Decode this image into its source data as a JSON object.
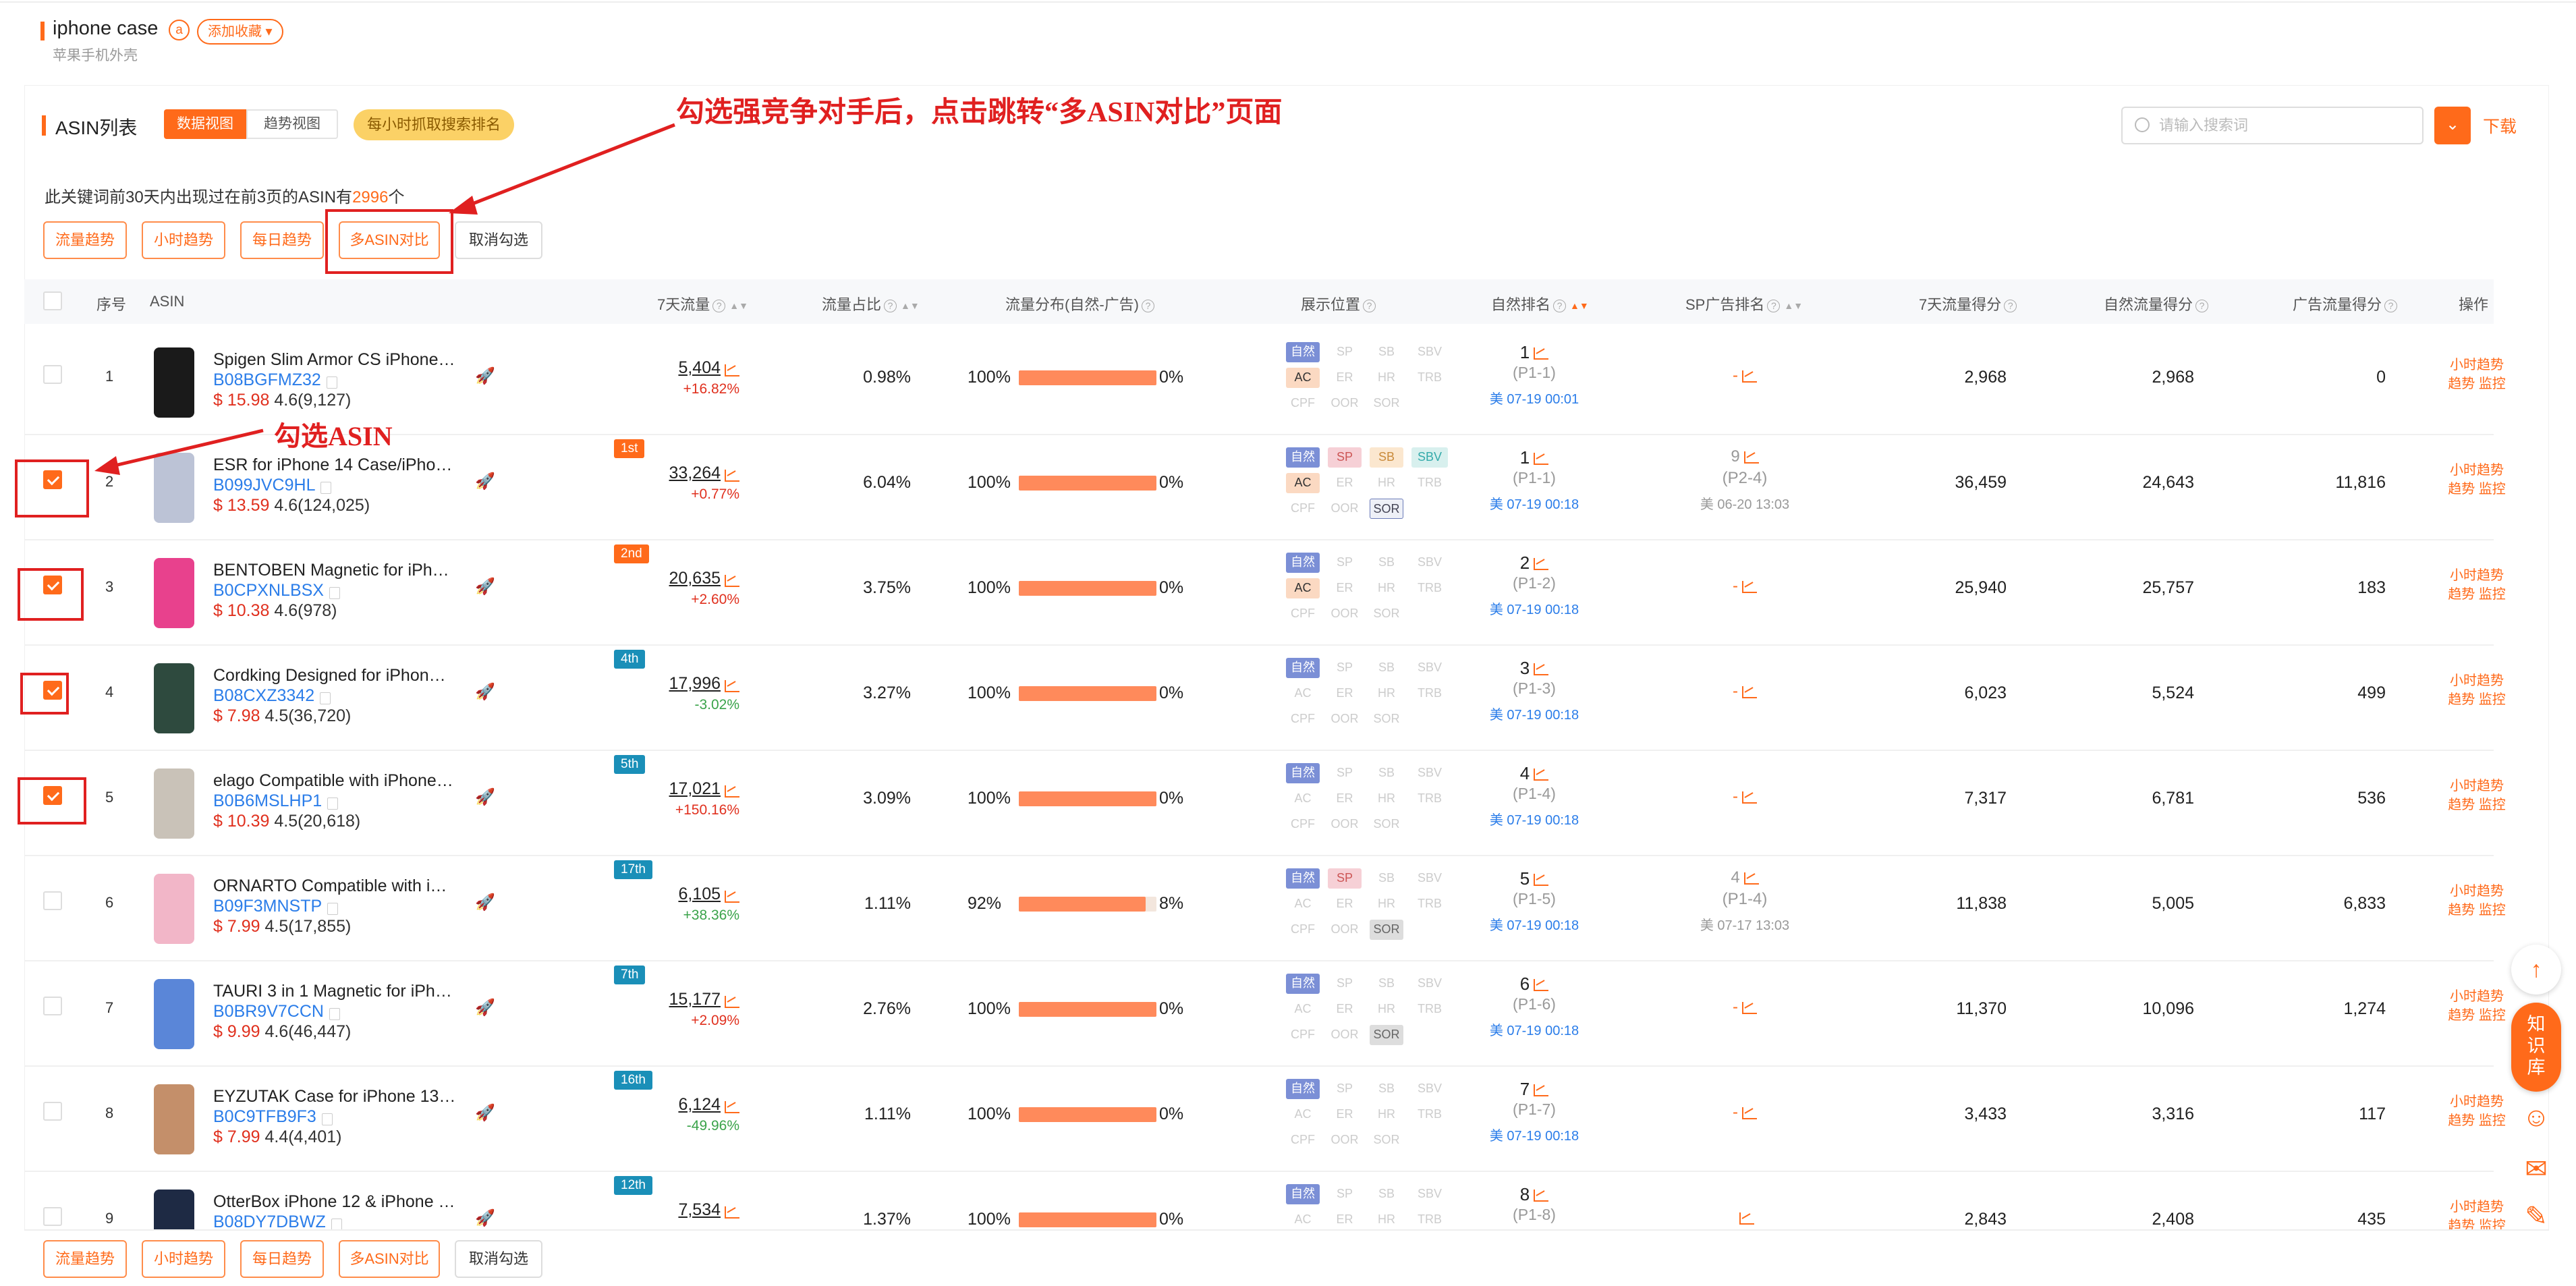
{
  "header": {
    "keyword": "iphone case",
    "badge": "a",
    "favorite": "添加收藏 ▾",
    "subtitle": "苹果手机外壳"
  },
  "section": {
    "title": "ASIN列表",
    "tab_data": "数据视图",
    "tab_trend": "趋势视图",
    "hourly_pill": "每小时抓取搜索排名"
  },
  "search": {
    "placeholder": "请输入搜索词",
    "dropdown": "⌄",
    "download": "下载"
  },
  "info": {
    "prefix": "此关键词前30天内出现过在前3页的ASIN有",
    "count": "2996",
    "suffix": "个"
  },
  "actions": {
    "traffic_trend": "流量趋势",
    "hourly_trend": "小时趋势",
    "daily_trend": "每日趋势",
    "multi_asin": "多ASIN对比",
    "cancel": "取消勾选"
  },
  "columns": {
    "index": "序号",
    "asin": "ASIN",
    "traffic7": "7天流量",
    "share": "流量占比",
    "dist": "流量分布(自然-广告)",
    "display": "展示位置",
    "natural_rank": "自然排名",
    "sp_rank": "SP广告排名",
    "score7": "7天流量得分",
    "natural_score": "自然流量得分",
    "ad_score": "广告流量得分",
    "ops": "操作"
  },
  "tag_labels": [
    "自然",
    "SP",
    "SB",
    "SBV",
    "AC",
    "ER",
    "HR",
    "TRB",
    "CPF",
    "OOR",
    "SOR"
  ],
  "ops_labels": {
    "hourly": "小时趋势",
    "trend": "趋势",
    "monitor": "监控"
  },
  "annotations": {
    "top": "勾选强竞争对手后，点击跳转“多ASIN对比”页面",
    "left": "勾选ASIN"
  },
  "colors": {
    "accent": "#ff6a1a",
    "link": "#2b7de9",
    "annotation": "#e02020"
  },
  "rows": [
    {
      "idx": "1",
      "title": "Spigen Slim Armor CS iPhone…",
      "asin": "B08BGFMZ32",
      "price": "$ 15.98",
      "rating": "4.6(9,127)",
      "badge": "",
      "traffic": "5,404",
      "change": "+16.82%",
      "up": true,
      "share": "0.98%",
      "nat_pct": "100%",
      "ad_pct": "0%",
      "nat_frac": 1.0,
      "tags": [
        "on",
        "off",
        "off",
        "off",
        "ac",
        "off",
        "off",
        "off",
        "off",
        "off",
        "off"
      ],
      "rank": "1",
      "page": "(P1-1)",
      "time": "美 07-19 00:01",
      "sp": "-",
      "sp_page": "",
      "sp_time": "",
      "s7": "2,968",
      "sn": "2,968",
      "sa": "0",
      "checked": false,
      "img": "black"
    },
    {
      "idx": "2",
      "title": "ESR for iPhone 14 Case/iPho…",
      "asin": "B099JVC9HL",
      "price": "$ 13.59",
      "rating": "4.6(124,025)",
      "badge": "1st",
      "traffic": "33,264",
      "change": "+0.77%",
      "up": true,
      "share": "6.04%",
      "nat_pct": "100%",
      "ad_pct": "0%",
      "nat_frac": 1.0,
      "tags": [
        "on",
        "sp",
        "sb",
        "sbv",
        "ac",
        "off",
        "off",
        "off",
        "off",
        "off",
        "sor"
      ],
      "rank": "1",
      "page": "(P1-1)",
      "time": "美 07-19 00:18",
      "sp": "9",
      "sp_page": "(P2-4)",
      "sp_time": "美 06-20 13:03",
      "s7": "36,459",
      "sn": "24,643",
      "sa": "11,816",
      "checked": true,
      "img": "clear"
    },
    {
      "idx": "3",
      "title": "BENTOBEN Magnetic for iPh…",
      "asin": "B0CPXNLBSX",
      "price": "$ 10.38",
      "rating": "4.6(978)",
      "badge": "2nd",
      "traffic": "20,635",
      "change": "+2.60%",
      "up": true,
      "share": "3.75%",
      "nat_pct": "100%",
      "ad_pct": "0%",
      "nat_frac": 1.0,
      "tags": [
        "on",
        "off",
        "off",
        "off",
        "ac",
        "off",
        "off",
        "off",
        "off",
        "off",
        "off"
      ],
      "rank": "2",
      "page": "(P1-2)",
      "time": "美 07-19 00:18",
      "sp": "-",
      "sp_page": "",
      "sp_time": "",
      "s7": "25,940",
      "sn": "25,757",
      "sa": "183",
      "checked": true,
      "img": "pink"
    },
    {
      "idx": "4",
      "title": "Cordking Designed for iPhon…",
      "asin": "B08CXZ3342",
      "price": "$ 7.98",
      "rating": "4.5(36,720)",
      "badge": "4th",
      "traffic": "17,996",
      "change": "-3.02%",
      "up": false,
      "share": "3.27%",
      "nat_pct": "100%",
      "ad_pct": "0%",
      "nat_frac": 1.0,
      "tags": [
        "on",
        "off",
        "off",
        "off",
        "off",
        "off",
        "off",
        "off",
        "off",
        "off",
        "off"
      ],
      "rank": "3",
      "page": "(P1-3)",
      "time": "美 07-19 00:18",
      "sp": "-",
      "sp_page": "",
      "sp_time": "",
      "s7": "6,023",
      "sn": "5,524",
      "sa": "499",
      "checked": true,
      "img": "green"
    },
    {
      "idx": "5",
      "title": "elago Compatible with iPhone…",
      "asin": "B0B6MSLHP1",
      "price": "$ 10.39",
      "rating": "4.5(20,618)",
      "badge": "5th",
      "traffic": "17,021",
      "change": "+150.16%",
      "up": true,
      "share": "3.09%",
      "nat_pct": "100%",
      "ad_pct": "0%",
      "nat_frac": 1.0,
      "tags": [
        "on",
        "off",
        "off",
        "off",
        "off",
        "off",
        "off",
        "off",
        "off",
        "off",
        "off"
      ],
      "rank": "4",
      "page": "(P1-4)",
      "time": "美 07-19 00:18",
      "sp": "-",
      "sp_page": "",
      "sp_time": "",
      "s7": "7,317",
      "sn": "6,781",
      "sa": "536",
      "checked": true,
      "img": "silver"
    },
    {
      "idx": "6",
      "title": "ORNARTO Compatible with i…",
      "asin": "B09F3MNSTP",
      "price": "$ 7.99",
      "rating": "4.5(17,855)",
      "badge": "17th",
      "traffic": "6,105",
      "change": "+38.36%",
      "up": false,
      "share": "1.11%",
      "nat_pct": "92%",
      "ad_pct": "8%",
      "nat_frac": 0.92,
      "tags": [
        "on",
        "sp",
        "off",
        "off",
        "off",
        "off",
        "off",
        "off",
        "off",
        "off",
        "sorg"
      ],
      "rank": "5",
      "page": "(P1-5)",
      "time": "美 07-19 00:18",
      "sp": "4",
      "sp_page": "(P1-4)",
      "sp_time": "美 07-17 13:03",
      "s7": "11,838",
      "sn": "5,005",
      "sa": "6,833",
      "checked": false,
      "img": "ribbon"
    },
    {
      "idx": "7",
      "title": "TAURI 3 in 1 Magnetic for iPh…",
      "asin": "B0BR9V7CCN",
      "price": "$ 9.99",
      "rating": "4.6(46,447)",
      "badge": "7th",
      "traffic": "15,177",
      "change": "+2.09%",
      "up": true,
      "share": "2.76%",
      "nat_pct": "100%",
      "ad_pct": "0%",
      "nat_frac": 1.0,
      "tags": [
        "on",
        "off",
        "off",
        "off",
        "off",
        "off",
        "off",
        "off",
        "off",
        "off",
        "sorg"
      ],
      "rank": "6",
      "page": "(P1-6)",
      "time": "美 07-19 00:18",
      "sp": "-",
      "sp_page": "",
      "sp_time": "",
      "s7": "11,370",
      "sn": "10,096",
      "sa": "1,274",
      "checked": false,
      "img": "blue"
    },
    {
      "idx": "8",
      "title": "EYZUTAK Case for iPhone 13…",
      "asin": "B0C9TFB9F3",
      "price": "$ 7.99",
      "rating": "4.4(4,401)",
      "badge": "16th",
      "traffic": "6,124",
      "change": "-49.96%",
      "up": false,
      "share": "1.11%",
      "nat_pct": "100%",
      "ad_pct": "0%",
      "nat_frac": 1.0,
      "tags": [
        "on",
        "off",
        "off",
        "off",
        "off",
        "off",
        "off",
        "off",
        "off",
        "off",
        "off"
      ],
      "rank": "7",
      "page": "(P1-7)",
      "time": "美 07-19 00:18",
      "sp": "-",
      "sp_page": "",
      "sp_time": "",
      "s7": "3,433",
      "sn": "3,316",
      "sa": "117",
      "checked": false,
      "img": "floral"
    },
    {
      "idx": "9",
      "title": "OtterBox iPhone 12 & iPhone …",
      "asin": "B08DY7DBWZ",
      "price": "",
      "rating": "",
      "badge": "12th",
      "traffic": "7,534",
      "change": "",
      "up": true,
      "share": "1.37%",
      "nat_pct": "100%",
      "ad_pct": "0%",
      "nat_frac": 1.0,
      "tags": [
        "on",
        "off",
        "off",
        "off",
        "off",
        "off",
        "off",
        "off",
        "off",
        "off",
        "off"
      ],
      "rank": "8",
      "page": "(P1-8)",
      "time": "",
      "sp": "",
      "sp_page": "",
      "sp_time": "",
      "s7": "2,843",
      "sn": "2,408",
      "sa": "435",
      "checked": false,
      "img": "navy"
    }
  ]
}
